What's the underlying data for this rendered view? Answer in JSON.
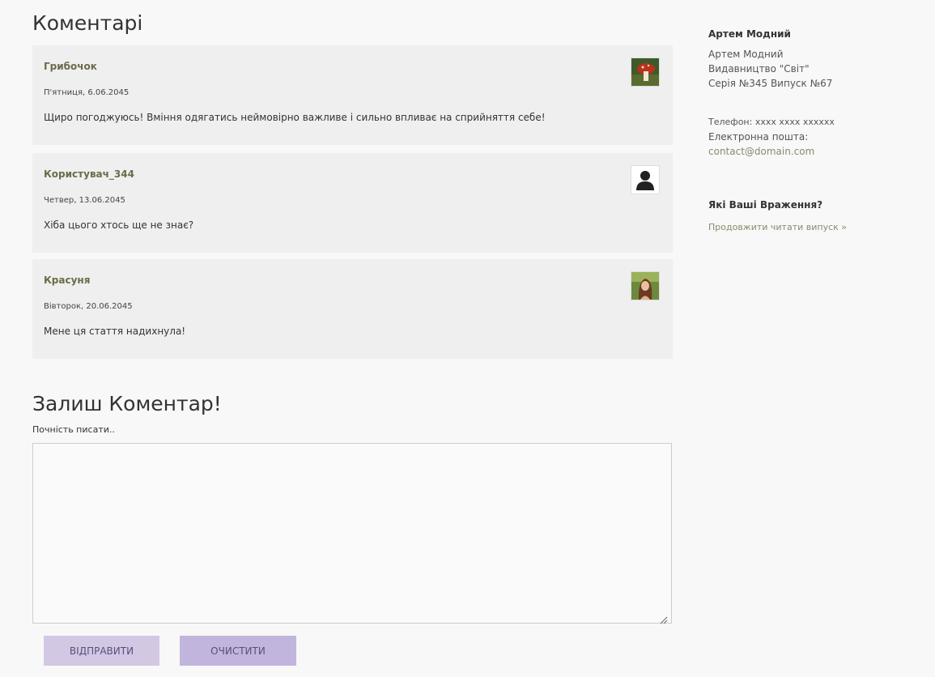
{
  "comments_section": {
    "title": "Коментарі"
  },
  "comments": [
    {
      "author": "Грибочок",
      "date": "П'ятниця, 6.06.2045",
      "text": "Щиро погоджуюсь! Вміння одягатись неймовірно важливе і сильно впливає на сприйняття себе!",
      "avatar": "mushroom-photo"
    },
    {
      "author": "Користувач_344",
      "date": "Четвер, 13.06.2045",
      "text": "Хіба цього хтось ще не знає?",
      "avatar": "default-user-icon"
    },
    {
      "author": "Красуня",
      "date": "Вівторок, 20.06.2045",
      "text": "Мене ця стаття надихнула!",
      "avatar": "woman-photo"
    }
  ],
  "form": {
    "title": "Залиш Коментар!",
    "hint": "Почність писати..",
    "textarea_value": "",
    "send_label": "ВІДПРАВИТИ",
    "clear_label": "ОЧИСТИТИ"
  },
  "sidebar": {
    "title": "Артем Модний",
    "name": "Артем Модний",
    "publisher": "Видавництво \"Світ\"",
    "series": "Серія №345 Випуск №67",
    "phone": "Телефон: xxxx xxxx xxxxxx",
    "email_label": "Електронна пошта:",
    "email": "contact@domain.com",
    "question": "Які Ваші Враження?",
    "continue_link": "Продовжити читати випуск »"
  },
  "colors": {
    "comment_bg": "#efefef",
    "author": "#6b6b4a",
    "send_button": "#d2c8e4",
    "clear_button": "#c2b5dd",
    "link": "#8a8a6e"
  }
}
